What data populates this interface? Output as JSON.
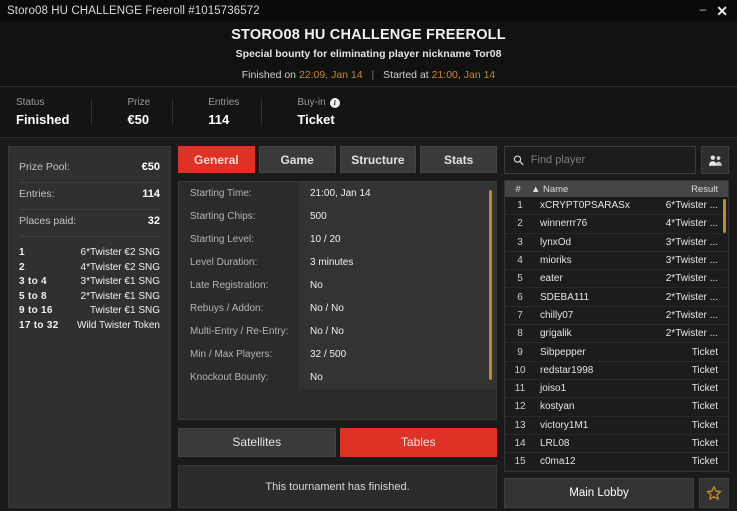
{
  "window": {
    "title": "Storo08 HU CHALLENGE Freeroll #1015736572",
    "minimize_label": "–",
    "close_label": "✕"
  },
  "header": {
    "title": "STORO08 HU CHALLENGE FREEROLL",
    "subtitle": "Special bounty for eliminating player nickname Tor08",
    "finished_prefix": "Finished on",
    "finished_time": "22:09, Jan 14",
    "separator": "|",
    "started_prefix": "Started at",
    "started_time": "21:00, Jan 14",
    "accent_amber": "#c18b2a"
  },
  "status": {
    "items": [
      {
        "label": "Status",
        "value": "Finished"
      },
      {
        "label": "Prize",
        "value": "€50"
      },
      {
        "label": "Entries",
        "value": "114"
      },
      {
        "label": "Buy-in",
        "value": "Ticket",
        "info_icon": "info-icon",
        "info_glyph": "i"
      }
    ]
  },
  "prize_pool": {
    "rows": [
      {
        "key": "Prize Pool:",
        "value": "€50"
      },
      {
        "key": "Entries:",
        "value": "114"
      },
      {
        "key": "Places paid:",
        "value": "32"
      }
    ],
    "payouts": [
      {
        "rank": "1",
        "reward": "6*Twister €2 SNG"
      },
      {
        "rank": "2",
        "reward": "4*Twister €2 SNG"
      },
      {
        "rank": "3  to  4",
        "reward": "3*Twister €1 SNG"
      },
      {
        "rank": "5  to  8",
        "reward": "2*Twister €1 SNG"
      },
      {
        "rank": "9  to  16",
        "reward": "Twister €1 SNG"
      },
      {
        "rank": "17  to  32",
        "reward": "Wild Twister Token"
      }
    ]
  },
  "tabs": [
    {
      "label": "General",
      "active": true
    },
    {
      "label": "Game",
      "active": false
    },
    {
      "label": "Structure",
      "active": false
    },
    {
      "label": "Stats",
      "active": false
    }
  ],
  "general_details": [
    {
      "key": "Starting Time:",
      "value": "21:00, Jan 14"
    },
    {
      "key": "Starting Chips:",
      "value": "500"
    },
    {
      "key": "Starting Level:",
      "value": "10 / 20"
    },
    {
      "key": "Level Duration:",
      "value": "3 minutes"
    },
    {
      "key": "Late Registration:",
      "value": "No"
    },
    {
      "key": "Rebuys / Addon:",
      "value": "No / No"
    },
    {
      "key": "Multi-Entry / Re-Entry:",
      "value": "No / No"
    },
    {
      "key": "Min / Max Players:",
      "value": "32 / 500"
    },
    {
      "key": "Knockout Bounty:",
      "value": "No"
    }
  ],
  "subtabs": [
    {
      "label": "Satellites",
      "active": false
    },
    {
      "label": "Tables",
      "active": true
    }
  ],
  "tables_panel": {
    "message": "This tournament has finished."
  },
  "search": {
    "placeholder": "Find player",
    "value": "",
    "icon": "search-icon",
    "people_icon": "people-icon"
  },
  "player_list": {
    "columns": {
      "num": "#",
      "sort": "▲",
      "name": "Name",
      "result": "Result"
    },
    "rows": [
      {
        "num": "1",
        "name": "xCRYPT0PSARASx",
        "result": "6*Twister ..."
      },
      {
        "num": "2",
        "name": "winnerrr76",
        "result": "4*Twister ..."
      },
      {
        "num": "3",
        "name": "lynxOd",
        "result": "3*Twister ..."
      },
      {
        "num": "4",
        "name": "mioriks",
        "result": "3*Twister ..."
      },
      {
        "num": "5",
        "name": "eater",
        "result": "2*Twister ..."
      },
      {
        "num": "6",
        "name": "SDEBA111",
        "result": "2*Twister ..."
      },
      {
        "num": "7",
        "name": "chilly07",
        "result": "2*Twister ..."
      },
      {
        "num": "8",
        "name": "grigalik",
        "result": "2*Twister ..."
      },
      {
        "num": "9",
        "name": "Sibpepper",
        "result": "Ticket"
      },
      {
        "num": "10",
        "name": "redstar1998",
        "result": "Ticket"
      },
      {
        "num": "11",
        "name": "joiso1",
        "result": "Ticket"
      },
      {
        "num": "12",
        "name": "kostyan",
        "result": "Ticket"
      },
      {
        "num": "13",
        "name": "victory1M1",
        "result": "Ticket"
      },
      {
        "num": "14",
        "name": "LRL08",
        "result": "Ticket"
      },
      {
        "num": "15",
        "name": "c0ma12",
        "result": "Ticket"
      }
    ]
  },
  "footer": {
    "main_lobby_label": "Main Lobby",
    "favorite_icon": "star-icon"
  }
}
